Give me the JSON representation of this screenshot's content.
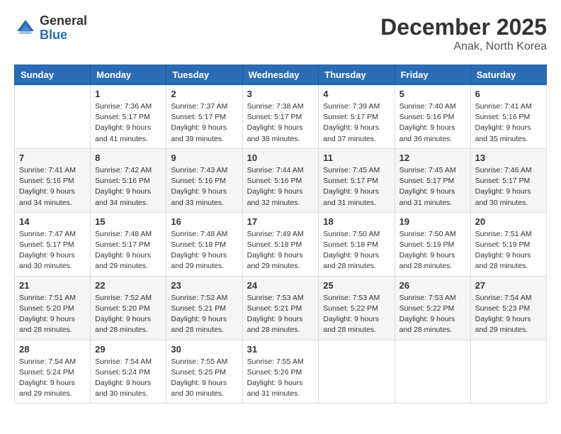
{
  "header": {
    "logo_general": "General",
    "logo_blue": "Blue",
    "month_year": "December 2025",
    "location": "Anak, North Korea"
  },
  "weekdays": [
    "Sunday",
    "Monday",
    "Tuesday",
    "Wednesday",
    "Thursday",
    "Friday",
    "Saturday"
  ],
  "weeks": [
    [
      {
        "day": "",
        "info": ""
      },
      {
        "day": "1",
        "info": "Sunrise: 7:36 AM\nSunset: 5:17 PM\nDaylight: 9 hours\nand 41 minutes."
      },
      {
        "day": "2",
        "info": "Sunrise: 7:37 AM\nSunset: 5:17 PM\nDaylight: 9 hours\nand 39 minutes."
      },
      {
        "day": "3",
        "info": "Sunrise: 7:38 AM\nSunset: 5:17 PM\nDaylight: 9 hours\nand 38 minutes."
      },
      {
        "day": "4",
        "info": "Sunrise: 7:39 AM\nSunset: 5:17 PM\nDaylight: 9 hours\nand 37 minutes."
      },
      {
        "day": "5",
        "info": "Sunrise: 7:40 AM\nSunset: 5:16 PM\nDaylight: 9 hours\nand 36 minutes."
      },
      {
        "day": "6",
        "info": "Sunrise: 7:41 AM\nSunset: 5:16 PM\nDaylight: 9 hours\nand 35 minutes."
      }
    ],
    [
      {
        "day": "7",
        "info": "Sunrise: 7:41 AM\nSunset: 5:16 PM\nDaylight: 9 hours\nand 34 minutes."
      },
      {
        "day": "8",
        "info": "Sunrise: 7:42 AM\nSunset: 5:16 PM\nDaylight: 9 hours\nand 34 minutes."
      },
      {
        "day": "9",
        "info": "Sunrise: 7:43 AM\nSunset: 5:16 PM\nDaylight: 9 hours\nand 33 minutes."
      },
      {
        "day": "10",
        "info": "Sunrise: 7:44 AM\nSunset: 5:16 PM\nDaylight: 9 hours\nand 32 minutes."
      },
      {
        "day": "11",
        "info": "Sunrise: 7:45 AM\nSunset: 5:17 PM\nDaylight: 9 hours\nand 31 minutes."
      },
      {
        "day": "12",
        "info": "Sunrise: 7:45 AM\nSunset: 5:17 PM\nDaylight: 9 hours\nand 31 minutes."
      },
      {
        "day": "13",
        "info": "Sunrise: 7:46 AM\nSunset: 5:17 PM\nDaylight: 9 hours\nand 30 minutes."
      }
    ],
    [
      {
        "day": "14",
        "info": "Sunrise: 7:47 AM\nSunset: 5:17 PM\nDaylight: 9 hours\nand 30 minutes."
      },
      {
        "day": "15",
        "info": "Sunrise: 7:48 AM\nSunset: 5:17 PM\nDaylight: 9 hours\nand 29 minutes."
      },
      {
        "day": "16",
        "info": "Sunrise: 7:48 AM\nSunset: 5:18 PM\nDaylight: 9 hours\nand 29 minutes."
      },
      {
        "day": "17",
        "info": "Sunrise: 7:49 AM\nSunset: 5:18 PM\nDaylight: 9 hours\nand 29 minutes."
      },
      {
        "day": "18",
        "info": "Sunrise: 7:50 AM\nSunset: 5:18 PM\nDaylight: 9 hours\nand 28 minutes."
      },
      {
        "day": "19",
        "info": "Sunrise: 7:50 AM\nSunset: 5:19 PM\nDaylight: 9 hours\nand 28 minutes."
      },
      {
        "day": "20",
        "info": "Sunrise: 7:51 AM\nSunset: 5:19 PM\nDaylight: 9 hours\nand 28 minutes."
      }
    ],
    [
      {
        "day": "21",
        "info": "Sunrise: 7:51 AM\nSunset: 5:20 PM\nDaylight: 9 hours\nand 28 minutes."
      },
      {
        "day": "22",
        "info": "Sunrise: 7:52 AM\nSunset: 5:20 PM\nDaylight: 9 hours\nand 28 minutes."
      },
      {
        "day": "23",
        "info": "Sunrise: 7:52 AM\nSunset: 5:21 PM\nDaylight: 9 hours\nand 28 minutes."
      },
      {
        "day": "24",
        "info": "Sunrise: 7:53 AM\nSunset: 5:21 PM\nDaylight: 9 hours\nand 28 minutes."
      },
      {
        "day": "25",
        "info": "Sunrise: 7:53 AM\nSunset: 5:22 PM\nDaylight: 9 hours\nand 28 minutes."
      },
      {
        "day": "26",
        "info": "Sunrise: 7:53 AM\nSunset: 5:22 PM\nDaylight: 9 hours\nand 28 minutes."
      },
      {
        "day": "27",
        "info": "Sunrise: 7:54 AM\nSunset: 5:23 PM\nDaylight: 9 hours\nand 29 minutes."
      }
    ],
    [
      {
        "day": "28",
        "info": "Sunrise: 7:54 AM\nSunset: 5:24 PM\nDaylight: 9 hours\nand 29 minutes."
      },
      {
        "day": "29",
        "info": "Sunrise: 7:54 AM\nSunset: 5:24 PM\nDaylight: 9 hours\nand 30 minutes."
      },
      {
        "day": "30",
        "info": "Sunrise: 7:55 AM\nSunset: 5:25 PM\nDaylight: 9 hours\nand 30 minutes."
      },
      {
        "day": "31",
        "info": "Sunrise: 7:55 AM\nSunset: 5:26 PM\nDaylight: 9 hours\nand 31 minutes."
      },
      {
        "day": "",
        "info": ""
      },
      {
        "day": "",
        "info": ""
      },
      {
        "day": "",
        "info": ""
      }
    ]
  ]
}
